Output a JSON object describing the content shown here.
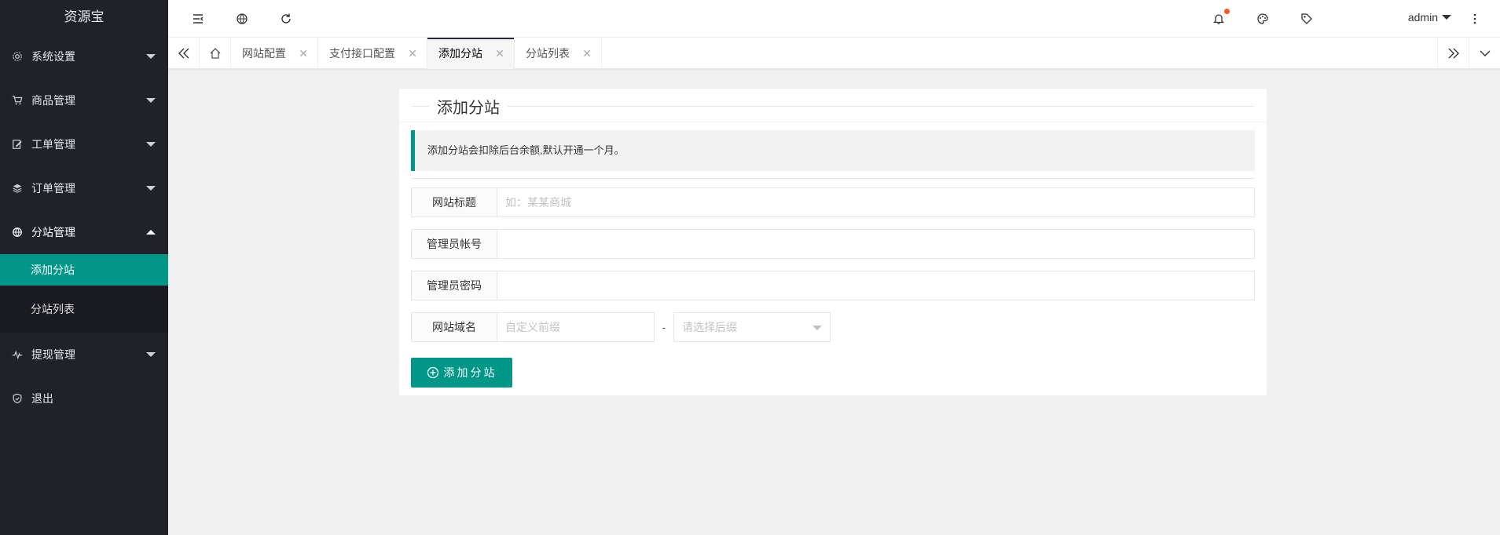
{
  "sidebar": {
    "logo": "资源宝",
    "items": [
      {
        "label": "系统设置",
        "icon": "gear-icon"
      },
      {
        "label": "商品管理",
        "icon": "cart-icon"
      },
      {
        "label": "工单管理",
        "icon": "edit-icon"
      },
      {
        "label": "订单管理",
        "icon": "layers-icon"
      },
      {
        "label": "分站管理",
        "icon": "globe-icon",
        "expanded": true
      },
      {
        "label": "提现管理",
        "icon": "pulse-icon"
      },
      {
        "label": "退出",
        "icon": "shield-check-icon"
      }
    ],
    "subitems": [
      {
        "label": "添加分站",
        "active": true
      },
      {
        "label": "分站列表"
      }
    ]
  },
  "header": {
    "icons": [
      "menu-fold-icon",
      "globe-icon",
      "refresh-icon",
      "bell-icon",
      "theme-icon",
      "tag-icon",
      "more-icon"
    ],
    "user": "admin"
  },
  "tabs": [
    {
      "label": "网站配置"
    },
    {
      "label": "支付接口配置"
    },
    {
      "label": "添加分站",
      "active": true
    },
    {
      "label": "分站列表"
    }
  ],
  "form": {
    "title": "添加分站",
    "notice": "添加分站会扣除后台余额,默认开通一个月。",
    "fields": [
      {
        "label": "网站标题",
        "value": "",
        "placeholder": "如：某某商城"
      },
      {
        "label": "管理员帐号",
        "value": "",
        "placeholder": ""
      },
      {
        "label": "管理员密码",
        "value": "",
        "placeholder": ""
      }
    ],
    "domain": {
      "label": "网站域名",
      "prefix_placeholder": "自定义前缀",
      "separator": "-",
      "suffix_placeholder": "请选择后缀"
    },
    "submit_label": "添加分站"
  },
  "colors": {
    "sidebar_bg": "#20222a",
    "accent": "#009688",
    "notify_dot": "#ff5722"
  }
}
